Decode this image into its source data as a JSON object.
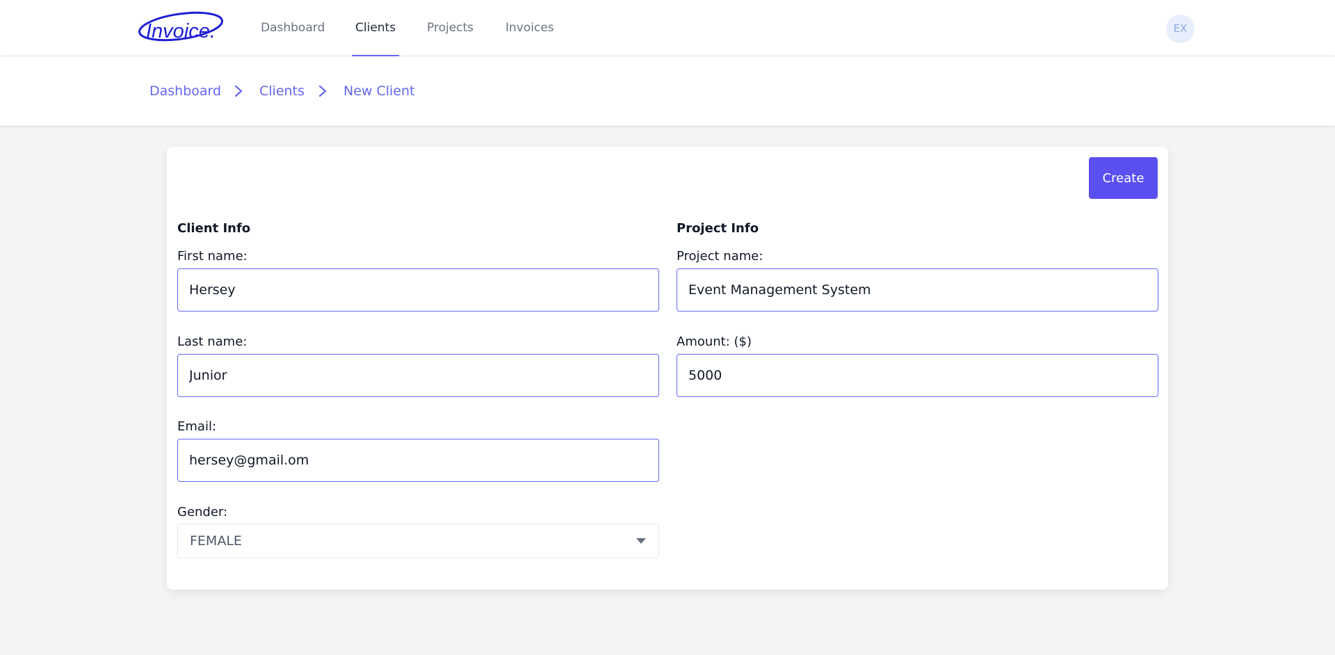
{
  "brand": {
    "logo_text": "Invoice."
  },
  "nav": {
    "items": [
      {
        "label": "Dashboard",
        "active": false
      },
      {
        "label": "Clients",
        "active": true
      },
      {
        "label": "Projects",
        "active": false
      },
      {
        "label": "Invoices",
        "active": false
      }
    ],
    "avatar_initials": "EX"
  },
  "breadcrumb": [
    "Dashboard",
    "Clients",
    "New Client"
  ],
  "form": {
    "create_label": "Create",
    "client_info": {
      "title": "Client Info",
      "first_name": {
        "label": "First name:",
        "value": "Hersey"
      },
      "last_name": {
        "label": "Last name:",
        "value": "Junior"
      },
      "email": {
        "label": "Email:",
        "value": "hersey@gmail.om"
      },
      "gender": {
        "label": "Gender:",
        "value": "FEMALE"
      }
    },
    "project_info": {
      "title": "Project Info",
      "project_name": {
        "label": "Project name:",
        "value": "Event Management System"
      },
      "amount": {
        "label": "Amount: ($)",
        "value": "5000"
      }
    }
  },
  "colors": {
    "accent": "#6366f1",
    "button": "#5a50f0",
    "background": "#f3f4f6"
  }
}
